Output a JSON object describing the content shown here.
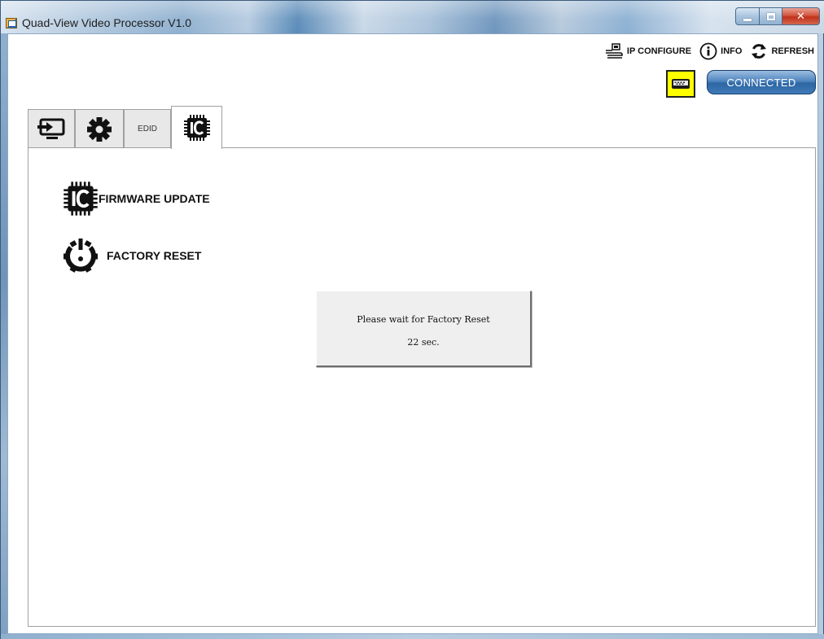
{
  "window": {
    "title": "Quad-View Video Processor V1.0",
    "minimize_label": "minimize",
    "maximize_label": "maximize",
    "close_label": "✕"
  },
  "toolbar": {
    "ip_configure_label": "IP CONFIGURE",
    "info_label": "INFO",
    "refresh_label": "REFRESH",
    "serial_port_icon": "serial-port-icon",
    "connection_status": "CONNECTED",
    "serial_highlight_color": "#ffff00",
    "status_button_color": "#2d66a3"
  },
  "tabs": [
    {
      "name": "input",
      "icon": "input-source-icon",
      "label": ""
    },
    {
      "name": "settings",
      "icon": "gear-icon",
      "label": ""
    },
    {
      "name": "edid",
      "icon": "",
      "label": "EDID"
    },
    {
      "name": "firmware",
      "icon": "ic-chip-icon",
      "label": "",
      "active": true
    }
  ],
  "panel": {
    "firmware_update_label": "FIRMWARE UPDATE",
    "factory_reset_label": "FACTORY RESET"
  },
  "dialog": {
    "message": "Please wait for Factory Reset",
    "countdown": "22 sec."
  }
}
